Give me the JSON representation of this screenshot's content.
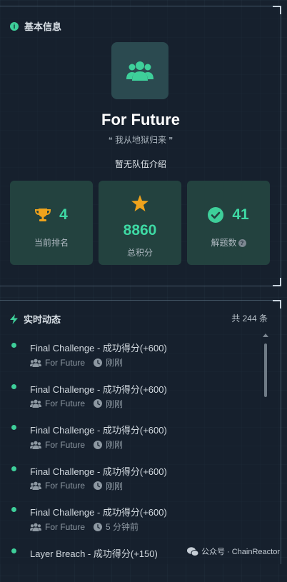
{
  "basic_info": {
    "section_title": "基本信息",
    "team_name": "For Future",
    "motto": "我从地狱归来",
    "intro": "暂无队伍介绍"
  },
  "stats": [
    {
      "value": "4",
      "label": "当前排名",
      "icon": "trophy-icon"
    },
    {
      "value": "8860",
      "label": "总积分",
      "icon": "star-icon"
    },
    {
      "value": "41",
      "label": "解题数",
      "icon": "check-circle-icon"
    }
  ],
  "activity": {
    "section_title": "实时动态",
    "count_text": "共 244 条",
    "items": [
      {
        "title": "Final Challenge - 成功得分(+600)",
        "team": "For Future",
        "time": "刚刚"
      },
      {
        "title": "Final Challenge - 成功得分(+600)",
        "team": "For Future",
        "time": "刚刚"
      },
      {
        "title": "Final Challenge - 成功得分(+600)",
        "team": "For Future",
        "time": "刚刚"
      },
      {
        "title": "Final Challenge - 成功得分(+600)",
        "team": "For Future",
        "time": "刚刚"
      },
      {
        "title": "Final Challenge - 成功得分(+600)",
        "team": "For Future",
        "time": "5 分钟前"
      },
      {
        "title": "Layer Breach - 成功得分(+150)",
        "team": "",
        "time": ""
      }
    ]
  },
  "watermark": {
    "text": "公众号 · ChainReactor"
  },
  "colors": {
    "accent": "#3ecf9a",
    "gold": "#f0a31c",
    "card_bg": "#23423f",
    "page_bg": "#17212e"
  }
}
